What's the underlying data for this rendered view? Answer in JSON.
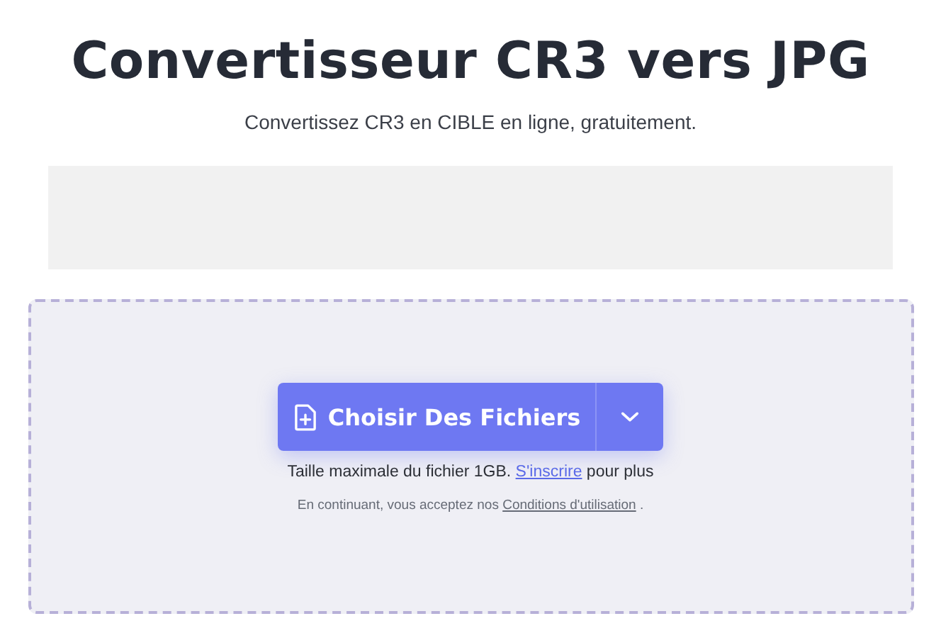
{
  "title": "Convertisseur CR3 vers JPG",
  "subtitle": "Convertissez CR3 en CIBLE en ligne, gratuitement.",
  "upload": {
    "button": "Choisir Des Fichiers",
    "size_note": {
      "before": "Taille maximale du fichier 1GB.",
      "link": "S'inscrire",
      "after": "pour plus"
    },
    "terms_note": {
      "before": "En continuant, vous acceptez nos",
      "link": "Conditions d'utilisation",
      "after": "."
    }
  }
}
